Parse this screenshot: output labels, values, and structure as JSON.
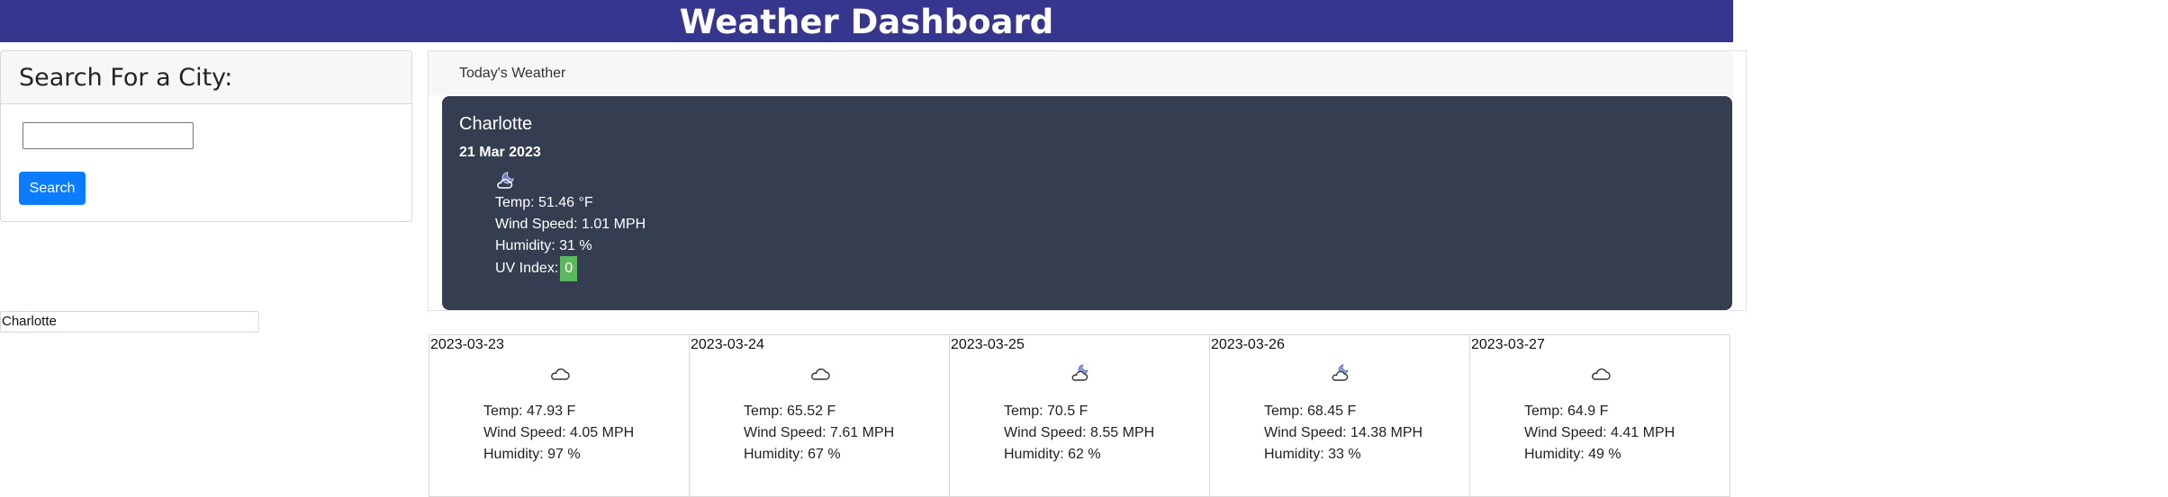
{
  "header": {
    "title": "Weather Dashboard",
    "background": "#37368f"
  },
  "search": {
    "title": "Search For a City:",
    "input_value": "",
    "placeholder": "",
    "button_label": "Search",
    "button_color": "#0a7cfd"
  },
  "history": [
    "Charlotte"
  ],
  "today": {
    "panel_title": "Today's Weather",
    "city": "Charlotte",
    "date": "21 Mar 2023",
    "icon": "partly-cloudy-night-icon",
    "temp_text": "Temp: 51.46 °F",
    "wind_text": "Wind Speed: 1.01 MPH",
    "humidity_text": "Humidity: 31 %",
    "uv_label": "UV Index:",
    "uv_value": "0",
    "uv_color": "#5cb85c",
    "card_color": "#343e50"
  },
  "forecast": [
    {
      "date": "2023-03-23",
      "icon": "cloud-icon",
      "temp": "Temp: 47.93 F",
      "wind": "Wind Speed: 4.05 MPH",
      "humidity": "Humidity: 97 %"
    },
    {
      "date": "2023-03-24",
      "icon": "cloud-icon",
      "temp": "Temp: 65.52 F",
      "wind": "Wind Speed: 7.61 MPH",
      "humidity": "Humidity: 67 %"
    },
    {
      "date": "2023-03-25",
      "icon": "partly-cloudy-night-icon",
      "temp": "Temp: 70.5 F",
      "wind": "Wind Speed: 8.55 MPH",
      "humidity": "Humidity: 62 %"
    },
    {
      "date": "2023-03-26",
      "icon": "partly-cloudy-night-icon",
      "temp": "Temp: 68.45 F",
      "wind": "Wind Speed: 14.38 MPH",
      "humidity": "Humidity: 33 %"
    },
    {
      "date": "2023-03-27",
      "icon": "cloud-icon",
      "temp": "Temp: 64.9 F",
      "wind": "Wind Speed: 4.41 MPH",
      "humidity": "Humidity: 49 %"
    }
  ]
}
